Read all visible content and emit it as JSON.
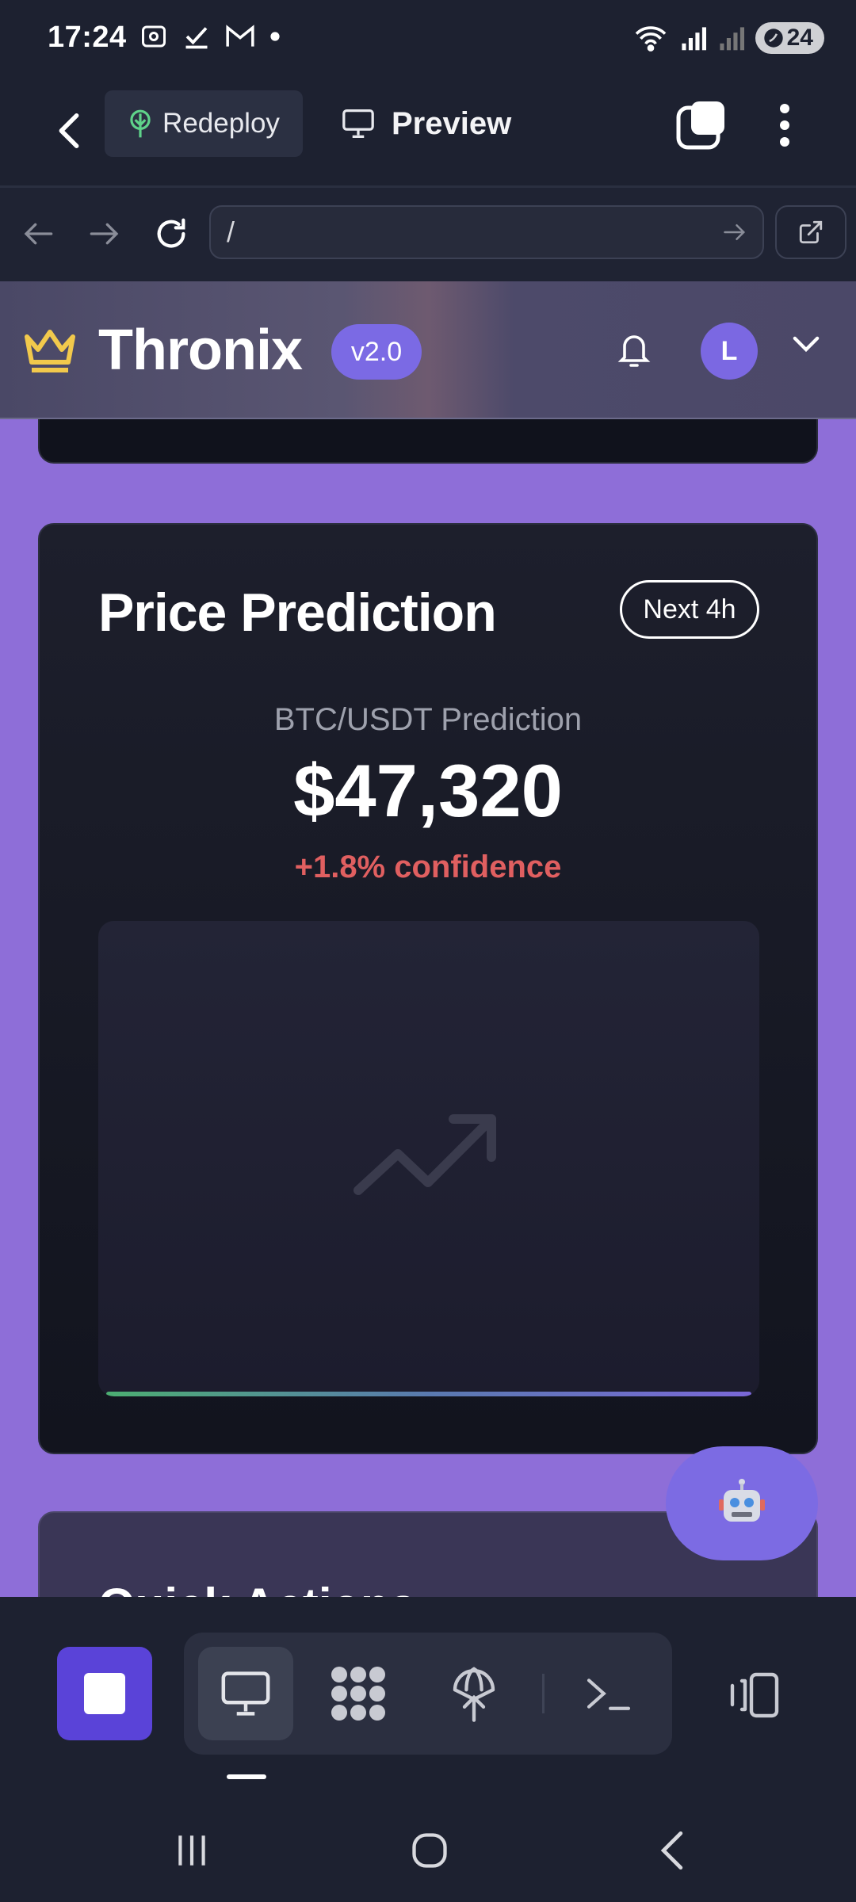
{
  "status_bar": {
    "time": "17:24",
    "battery": "24",
    "left_icons": [
      "screenshot-icon",
      "check-icon",
      "gmail-icon",
      "notification-dot-icon"
    ],
    "right_icons": [
      "wifi-icon",
      "signal-icon",
      "signal-weak-icon",
      "battery-saver-icon"
    ]
  },
  "toolbar": {
    "redeploy_label": "Redeploy",
    "preview_label": "Preview"
  },
  "browser": {
    "url": "/"
  },
  "site": {
    "brand": "Thronix",
    "version": "v2.0",
    "avatar_initial": "L"
  },
  "prediction_card": {
    "title": "Price Prediction",
    "period": "Next 4h",
    "pair_label": "BTC/USDT Prediction",
    "price": "$47,320",
    "confidence": "+1.8% confidence"
  },
  "next_card": {
    "title": "Quick Actions"
  },
  "colors": {
    "page_background": "#8e6ed8",
    "accent": "#7b6ae4",
    "confidence_red": "#e05f60",
    "stop_button": "#5a43d8",
    "crown_gold": "#f2c94c"
  }
}
